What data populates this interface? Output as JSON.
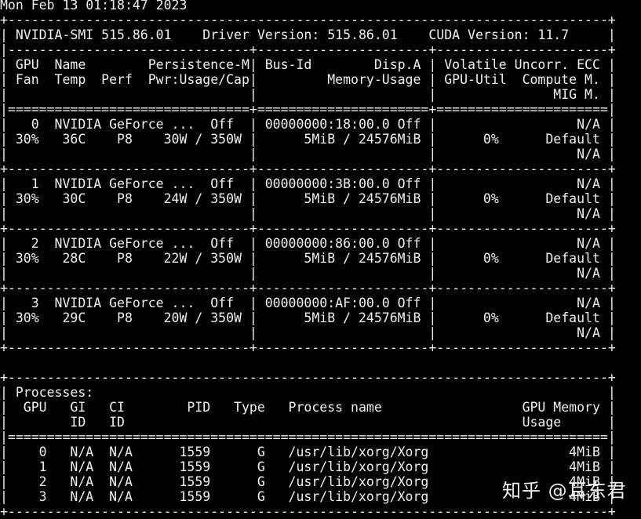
{
  "colors": {
    "background": "#000000",
    "text": "#f0f0f0"
  },
  "terminal": {
    "timestamp": "Mon Feb 13 01:18:47 2023",
    "lines": [
      "+-----------------------------------------------------------------------------+",
      "| NVIDIA-SMI 515.86.01    Driver Version: 515.86.01    CUDA Version: 11.7     |",
      "|-------------------------------+----------------------+----------------------+",
      "| GPU  Name        Persistence-M| Bus-Id        Disp.A | Volatile Uncorr. ECC |",
      "| Fan  Temp  Perf  Pwr:Usage/Cap|         Memory-Usage | GPU-Util  Compute M. |",
      "|                               |                      |               MIG M. |",
      "|===============================+======================+======================|",
      "|   0  NVIDIA GeForce ...  Off  | 00000000:18:00.0 Off |                  N/A |",
      "| 30%   36C    P8    30W / 350W |      5MiB / 24576MiB |      0%      Default |",
      "|                               |                      |                  N/A |",
      "+-------------------------------+----------------------+----------------------+",
      "|   1  NVIDIA GeForce ...  Off  | 00000000:3B:00.0 Off |                  N/A |",
      "| 30%   30C    P8    24W / 350W |      5MiB / 24576MiB |      0%      Default |",
      "|                               |                      |                  N/A |",
      "+-------------------------------+----------------------+----------------------+",
      "|   2  NVIDIA GeForce ...  Off  | 00000000:86:00.0 Off |                  N/A |",
      "| 30%   28C    P8    22W / 350W |      5MiB / 24576MiB |      0%      Default |",
      "|                               |                      |                  N/A |",
      "+-------------------------------+----------------------+----------------------+",
      "|   3  NVIDIA GeForce ...  Off  | 00000000:AF:00.0 Off |                  N/A |",
      "| 30%   29C    P8    20W / 350W |      5MiB / 24576MiB |      0%      Default |",
      "|                               |                      |                  N/A |",
      "+-------------------------------+----------------------+----------------------+",
      "",
      "+-----------------------------------------------------------------------------+",
      "| Processes:                                                                  |",
      "|  GPU   GI   CI        PID   Type   Process name                  GPU Memory |",
      "|        ID   ID                                                   Usage      |",
      "|=============================================================================|",
      "|    0   N/A  N/A      1559      G   /usr/lib/xorg/Xorg                  4MiB |",
      "|    1   N/A  N/A      1559      G   /usr/lib/xorg/Xorg                  4MiB |",
      "|    2   N/A  N/A      1559      G   /usr/lib/xorg/Xorg                  4MiB |",
      "|    3   N/A  N/A      1559      G   /usr/lib/xorg/Xorg                  4MiB |",
      "+-----------------------------------------------------------------------------+"
    ]
  },
  "watermark": {
    "text": "知乎 @耳东君"
  }
}
